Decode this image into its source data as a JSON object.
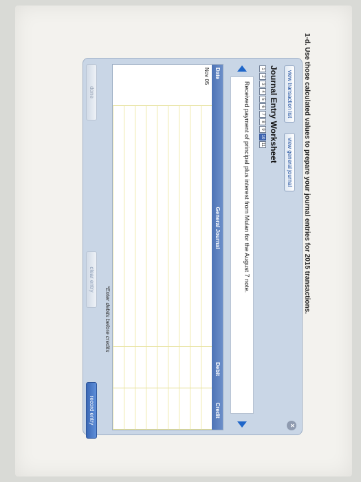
{
  "question": "1-d. Use those calculated values to prepare your journal entries for 2015 transactions.",
  "tabs": {
    "transaction_list": "view transaction list",
    "general_journal": "view general journal"
  },
  "close_icon": "×",
  "worksheet": {
    "title": "Journal Entry Worksheet",
    "steps": [
      "1",
      "2",
      "3",
      "4",
      "5",
      "6",
      "7",
      "8",
      "9",
      "10",
      "11"
    ],
    "active_step": "10",
    "description": "Received payment of principal plus interest from Mulan for the August 7 note."
  },
  "table": {
    "headers": {
      "date": "Date",
      "general_journal": "General Journal",
      "debit": "Debit",
      "credit": "Credit"
    },
    "date_value": "Nov 05",
    "rows": 9
  },
  "hint": "*Enter debits before credits",
  "buttons": {
    "done": "done",
    "clear": "clear entry",
    "record": "record entry"
  }
}
